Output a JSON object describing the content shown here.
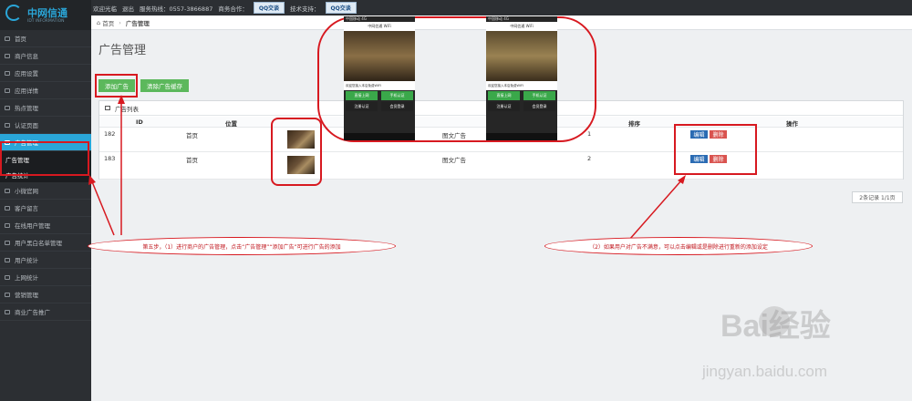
{
  "brand": {
    "name": "中网信通",
    "subtitle": "IDT INFORMATION"
  },
  "topbar": {
    "welcome": "欢迎光临",
    "logout": "退出",
    "hotline": "服务热线：0557-3866887",
    "business": "商务合作：",
    "qq1": "QQ交谈",
    "tech": "技术支持：",
    "qq2": "QQ交谈"
  },
  "sidebar": {
    "items": [
      {
        "label": "首页"
      },
      {
        "label": "商户信息"
      },
      {
        "label": "应用设置"
      },
      {
        "label": "应用详情"
      },
      {
        "label": "热点管理"
      },
      {
        "label": "认证页面"
      },
      {
        "label": "广告管理"
      },
      {
        "label": "广告管理"
      },
      {
        "label": "广告统计"
      },
      {
        "label": "小微官网"
      },
      {
        "label": "客户留言"
      },
      {
        "label": "在线用户管理"
      },
      {
        "label": "用户黑白名单管理"
      },
      {
        "label": "用户统计"
      },
      {
        "label": "上网统计"
      },
      {
        "label": "营销管理"
      },
      {
        "label": "商业广告推广"
      }
    ]
  },
  "breadcrumb": {
    "home": "首页",
    "current": "广告管理"
  },
  "page": {
    "title": "广告管理",
    "add_button": "添加广告",
    "clear_button": "清除广告缓存"
  },
  "table": {
    "title": "广告列表",
    "headers": {
      "id": "ID",
      "position": "位置",
      "type_col": "",
      "sort": "排序",
      "action": "操作"
    },
    "rows": [
      {
        "id": "182",
        "position": "首页",
        "type": "图文广告",
        "sort": "1",
        "edit": "编辑",
        "delete": "删除"
      },
      {
        "id": "183",
        "position": "首页",
        "type": "图文广告",
        "sort": "2",
        "edit": "编辑",
        "delete": "删除"
      }
    ],
    "pager": "2条记录 1/1页"
  },
  "phones": [
    {
      "status": "中国移动 4G",
      "title": "中网信通 WiFi",
      "wifi_text": "欢迎您接入本店免费WIFI",
      "btn1": "直接上网",
      "btn2": "手机认证",
      "btn3": "注册认证",
      "btn4": "会员登录"
    },
    {
      "status": "中国移动 4G",
      "title": "中网信通 WiFi",
      "wifi_text": "欢迎您接入本店免费WIFI",
      "btn1": "直接上网",
      "btn2": "手机认证",
      "btn3": "注册认证",
      "btn4": "会员登录"
    }
  ],
  "annotations": {
    "tip1": "第五步，（1）进行商户的广告管理，点击“广告管理”“添加广告”可进行广告的添加",
    "tip2": "（2）如果用户对广告不满意，可以点击编辑或是删除进行重新的添加设定"
  },
  "watermark": {
    "main": "Bai经验",
    "url": "jingyan.baidu.com"
  },
  "colors": {
    "accent": "#2aa6d8",
    "green": "#5cb85c",
    "edit": "#2a6bb3",
    "delete": "#d9534f",
    "annotation": "#d71920"
  }
}
